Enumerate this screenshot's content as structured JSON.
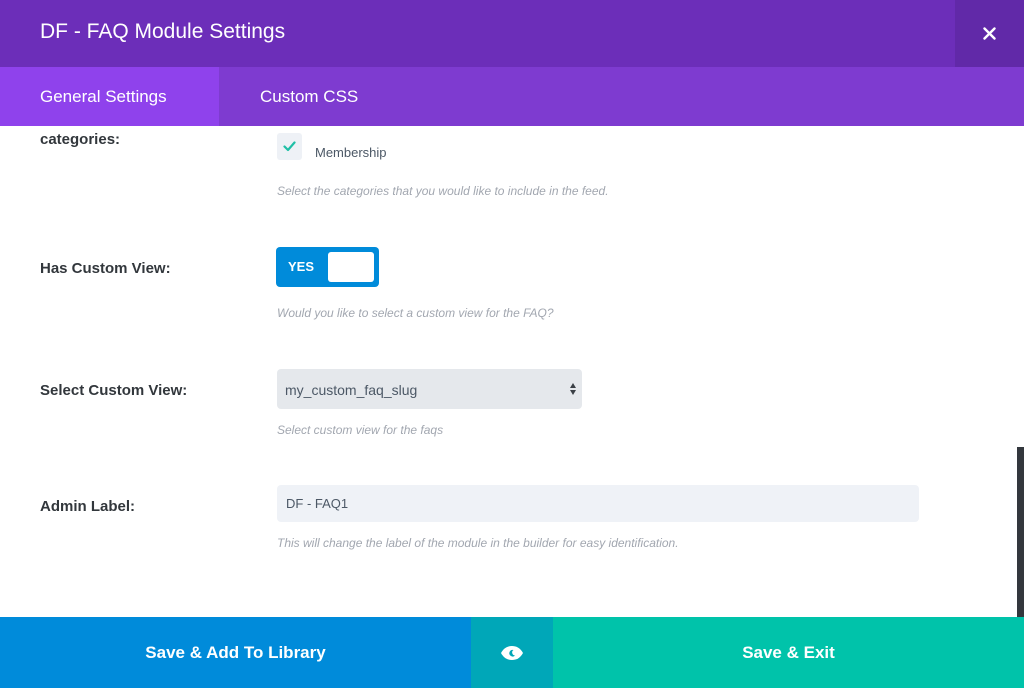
{
  "header": {
    "title": "DF - FAQ Module Settings",
    "close_icon": "close-icon"
  },
  "tabs": [
    {
      "label": "General Settings",
      "active": true
    },
    {
      "label": "Custom CSS",
      "active": false
    }
  ],
  "fields": {
    "categories": {
      "label": "categories:",
      "options": [
        {
          "label": "Membership",
          "checked": true
        }
      ],
      "description": "Select the categories that you would like to include in the feed."
    },
    "has_custom_view": {
      "label": "Has Custom View:",
      "toggle_text": "YES",
      "value": true,
      "description": "Would you like to select a custom view for the FAQ?"
    },
    "select_custom_view": {
      "label": "Select Custom View:",
      "value": "my_custom_faq_slug",
      "description": "Select custom view for the faqs"
    },
    "admin_label": {
      "label": "Admin Label:",
      "value": "DF - FAQ1",
      "description": "This will change the label of the module in the builder for easy identification."
    }
  },
  "footer": {
    "save_library_label": "Save & Add To Library",
    "preview_icon": "eye-icon",
    "save_exit_label": "Save & Exit"
  },
  "colors": {
    "header_bg": "#6c2eb9",
    "tab_bar_bg": "#7e3bd0",
    "active_tab_bg": "#8f42ec",
    "toggle_bg": "#008bda",
    "save_library_bg": "#008bda",
    "preview_bg": "#00a7b8",
    "save_exit_bg": "#00c3aa",
    "checkmark": "#1fbfa6"
  }
}
